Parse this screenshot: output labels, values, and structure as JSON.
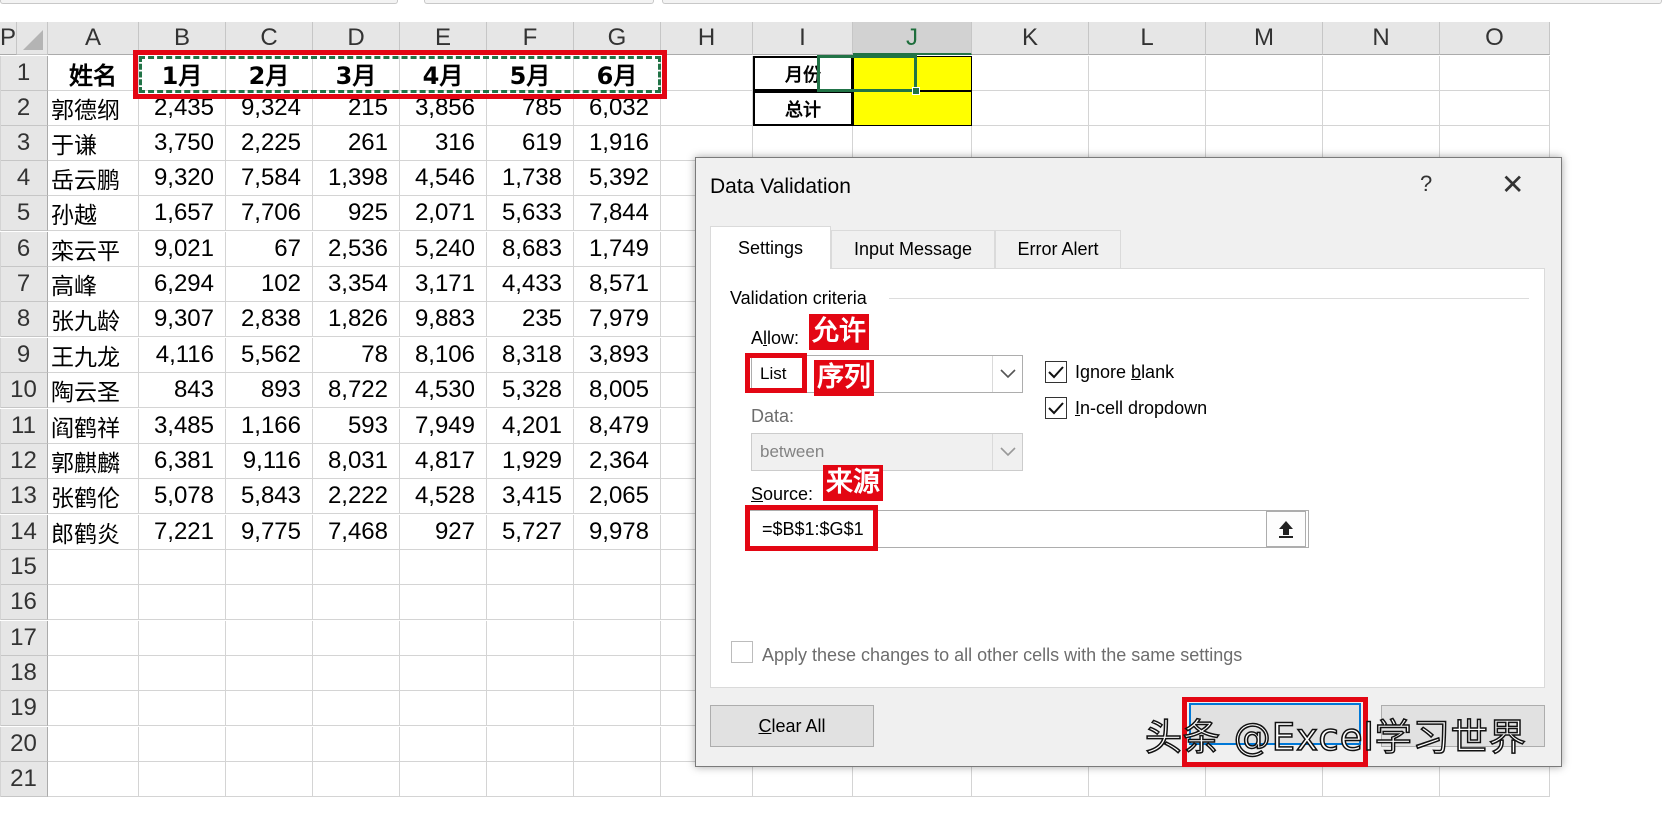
{
  "sheet": {
    "columns": [
      "A",
      "B",
      "C",
      "D",
      "E",
      "F",
      "G",
      "H",
      "I",
      "J",
      "K",
      "L",
      "M",
      "N",
      "O",
      "P"
    ],
    "rows": [
      "1",
      "2",
      "3",
      "4",
      "5",
      "6",
      "7",
      "8",
      "9",
      "10",
      "11",
      "12",
      "13",
      "14",
      "15",
      "16",
      "17",
      "18",
      "19",
      "20",
      "21"
    ],
    "selected_column": "J",
    "header_row": [
      "姓名",
      "1月",
      "2月",
      "3月",
      "4月",
      "5月",
      "6月"
    ],
    "data": [
      [
        "郭德纲",
        "2,435",
        "9,324",
        "215",
        "3,856",
        "785",
        "6,032"
      ],
      [
        "于谦",
        "3,750",
        "2,225",
        "261",
        "316",
        "619",
        "1,916"
      ],
      [
        "岳云鹏",
        "9,320",
        "7,584",
        "1,398",
        "4,546",
        "1,738",
        "5,392"
      ],
      [
        "孙越",
        "1,657",
        "7,706",
        "925",
        "2,071",
        "5,633",
        "7,844"
      ],
      [
        "栾云平",
        "9,021",
        "67",
        "2,536",
        "5,240",
        "8,683",
        "1,749"
      ],
      [
        "高峰",
        "6,294",
        "102",
        "3,354",
        "3,171",
        "4,433",
        "8,571"
      ],
      [
        "张九龄",
        "9,307",
        "2,838",
        "1,826",
        "9,883",
        "235",
        "7,979"
      ],
      [
        "王九龙",
        "4,116",
        "5,562",
        "78",
        "8,106",
        "8,318",
        "3,893"
      ],
      [
        "陶云圣",
        "843",
        "893",
        "8,722",
        "4,530",
        "5,328",
        "8,005"
      ],
      [
        "阎鹤祥",
        "3,485",
        "1,166",
        "593",
        "7,949",
        "4,201",
        "8,479"
      ],
      [
        "郭麒麟",
        "6,381",
        "9,116",
        "8,031",
        "4,817",
        "1,929",
        "2,364"
      ],
      [
        "张鹤伦",
        "5,078",
        "5,843",
        "2,222",
        "4,528",
        "3,415",
        "2,065"
      ],
      [
        "郎鹤炎",
        "7,221",
        "9,775",
        "7,468",
        "927",
        "5,727",
        "9,978"
      ]
    ],
    "side_labels": [
      "月份",
      "总计"
    ]
  },
  "dialog": {
    "title": "Data Validation",
    "help": "?",
    "close": "✕",
    "tabs": [
      "Settings",
      "Input Message",
      "Error Alert"
    ],
    "active_tab": "Settings",
    "group_title": "Validation criteria",
    "allow_label_pre": "A",
    "allow_label_u": "l",
    "allow_label_post": "low:",
    "allow_value": "List",
    "data_label": "Data:",
    "data_value": "between",
    "source_label_pre": "",
    "source_label_u": "S",
    "source_label_post": "ource:",
    "source_value": "=$B$1:$G$1",
    "ignore_blank_pre": "Ignore ",
    "ignore_blank_u": "b",
    "ignore_blank_post": "lank",
    "ignore_blank_checked": true,
    "incell_pre": "",
    "incell_u": "I",
    "incell_post": "n-cell dropdown",
    "incell_checked": true,
    "apply_all": "Apply these changes to all other cells with the same settings",
    "apply_all_checked": false,
    "clear_all_pre": "",
    "clear_all_u": "C",
    "clear_all_post": "lear All"
  },
  "annotations": {
    "allow": "允许",
    "list": "序列",
    "source": "来源"
  },
  "watermark": "头条 @Excel学习世界",
  "colors": {
    "accent_green": "#217346",
    "annotation_red": "#e30613",
    "highlight_yellow": "#ffff00",
    "default_button_blue": "#0078d7"
  }
}
